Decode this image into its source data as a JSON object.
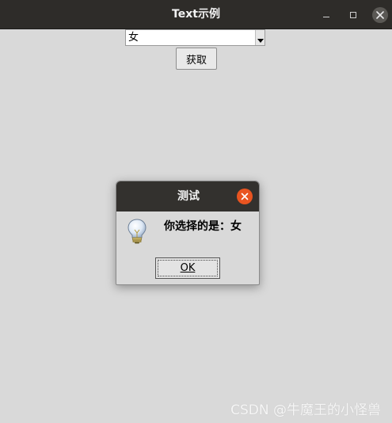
{
  "window": {
    "title": "Text示例"
  },
  "combo": {
    "value": "女"
  },
  "buttons": {
    "get_label": "获取"
  },
  "dialog": {
    "title": "测试",
    "message": "你选择的是：女",
    "ok_label": "OK",
    "icon": "lightbulb-info-icon"
  },
  "watermark": "CSDN @牛魔王的小怪兽",
  "colors": {
    "titlebar": "#2e2c29",
    "background": "#d9d9d9",
    "dialog_close": "#e95420"
  }
}
